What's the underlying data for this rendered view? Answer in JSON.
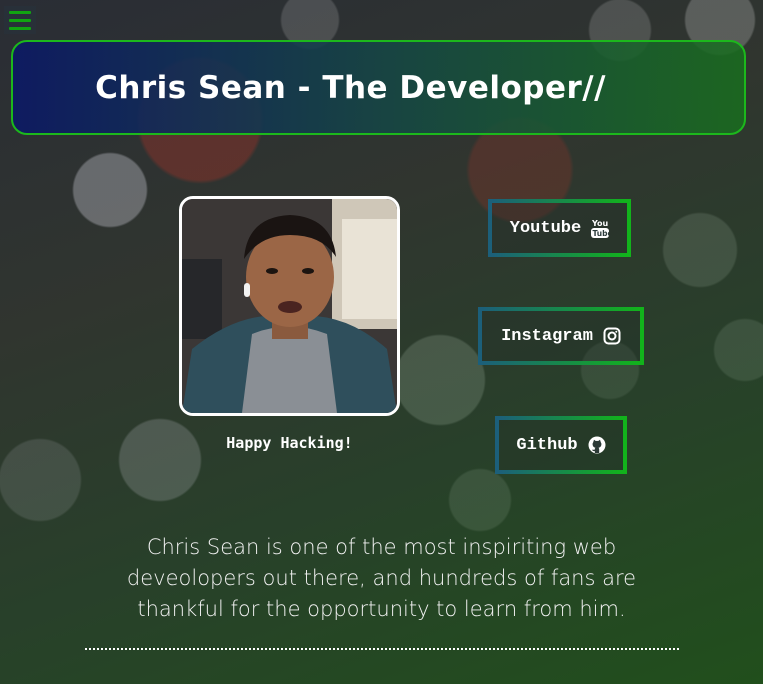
{
  "header": {
    "title": "Chris Sean - The Developer//"
  },
  "menu": {
    "icon": "hamburger-menu-icon",
    "color": "#11a311"
  },
  "profile": {
    "photo": "chris-sean-portrait",
    "caption": "Happy Hacking!"
  },
  "social_links": [
    {
      "label": "Youtube",
      "icon": "youtube-icon"
    },
    {
      "label": "Instagram",
      "icon": "instagram-icon"
    },
    {
      "label": "Github",
      "icon": "github-icon"
    }
  ],
  "description": "Chris Sean is one of the most inspiriting web deveolopers out there, and hundreds of fans are thankful for the opportunity to learn from him.",
  "colors": {
    "accent_green": "#1cb81c",
    "header_blue": "#0c1964",
    "button_border_start": "#1c5f7a",
    "button_border_end": "#12b31b"
  }
}
